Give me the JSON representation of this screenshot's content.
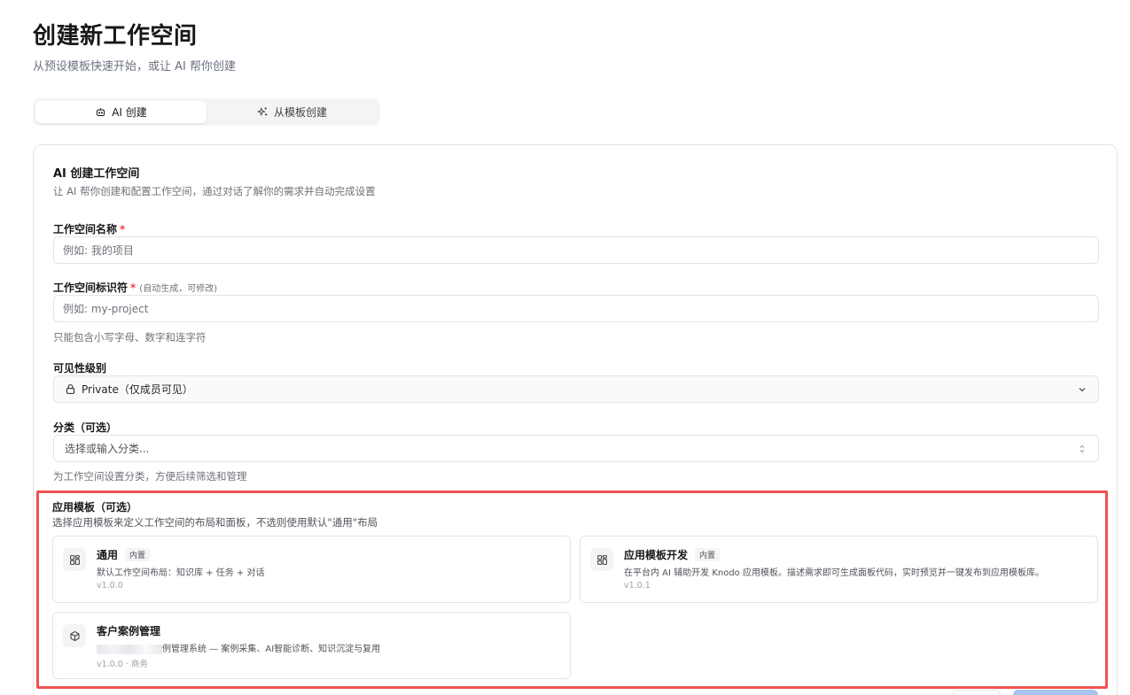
{
  "page": {
    "title": "创建新工作空间",
    "subtitle": "从预设模板快速开始，或让 AI 帮你创建"
  },
  "tabs": [
    {
      "label": "AI 创建",
      "icon": "bot-icon",
      "active": true
    },
    {
      "label": "从模板创建",
      "icon": "sparkles-icon",
      "active": false
    }
  ],
  "form": {
    "title": "AI 创建工作空间",
    "description": "让 AI 帮你创建和配置工作空间，通过对话了解你的需求并自动完成设置",
    "name": {
      "label": "工作空间名称",
      "required_mark": "*",
      "value": "",
      "placeholder": "例如: 我的项目"
    },
    "identifier": {
      "label": "工作空间标识符",
      "required_mark": "*",
      "hint": "(自动生成，可修改)",
      "value": "",
      "placeholder": "例如: my-project",
      "help": "只能包含小写字母、数字和连字符"
    },
    "visibility": {
      "label": "可见性级别",
      "selected": "Private（仅成员可见）",
      "icon": "lock-icon"
    },
    "category": {
      "label": "分类（可选）",
      "placeholder": "选择或输入分类...",
      "help": "为工作空间设置分类，方便后续筛选和管理"
    }
  },
  "templates_section": {
    "title": "应用模板（可选）",
    "description": "选择应用模板来定义工作空间的布局和面板，不选则使用默认\"通用\"布局",
    "highlight_color": "#ef5350",
    "templates": [
      {
        "name": "通用",
        "badge": "内置",
        "description": "默认工作空间布局：知识库 + 任务 + 对话",
        "version": "v1.0.0",
        "icon": "layout-grid-icon"
      },
      {
        "name": "应用模板开发",
        "badge": "内置",
        "description": "在平台内 AI 辅助开发 Knodo 应用模板。描述需求即可生成面板代码，实时预览并一键发布到应用模板库。",
        "version": "v1.0.1",
        "icon": "layout-grid-icon"
      },
      {
        "name": "客户案例管理",
        "badge": "",
        "description": "例管理系统 — 案例采集、AI智能诊断、知识沉淀与复用",
        "version": "v1.0.0 · 商务",
        "icon": "package-icon"
      }
    ]
  },
  "colors": {
    "primary_button": "#a5c4f0",
    "required": "#ef4444"
  }
}
